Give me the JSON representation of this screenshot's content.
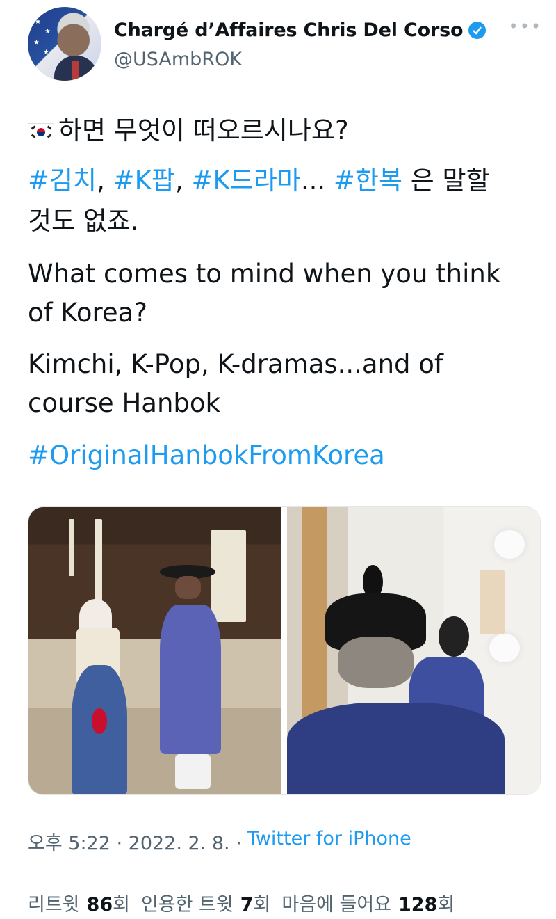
{
  "author": {
    "name": "Chargé d’Affaires Chris Del Corso",
    "handle": "@USAmbROK",
    "verified_icon": "verified-badge-icon",
    "more_icon": "more-dots-icon"
  },
  "tweet": {
    "line1": "하면 무엇이 떠오르시나요?",
    "line2": {
      "tag1": "#김치",
      "sep1": ", ",
      "tag2": "#K팝",
      "sep2": ", ",
      "tag3": "#K드라마",
      "ellipsis": "... ",
      "tag4": "#한복",
      "rest": " 은 말할"
    },
    "line3": "것도 없죠.",
    "english1": "What comes to mind when you think of Korea?",
    "english2": "Kimchi, K-Pop, K-dramas...and of course Hanbok",
    "hashtag_final": "#OriginalHanbokFromKorea"
  },
  "meta": {
    "time": "오후 5:22 · 2022. 2. 8. ·",
    "source": "Twitter for iPhone"
  },
  "stats": {
    "retweets_label": "리트윗",
    "retweets_count": "86",
    "retweets_suffix": "회",
    "quotes_label": "인용한 트윗",
    "quotes_count": "7",
    "quotes_suffix": "회",
    "likes_label": "마음에 들어요",
    "likes_count": "128",
    "likes_suffix": "회"
  },
  "colors": {
    "link": "#1d9bf0",
    "text": "#0f1419",
    "secondary": "#536471"
  }
}
